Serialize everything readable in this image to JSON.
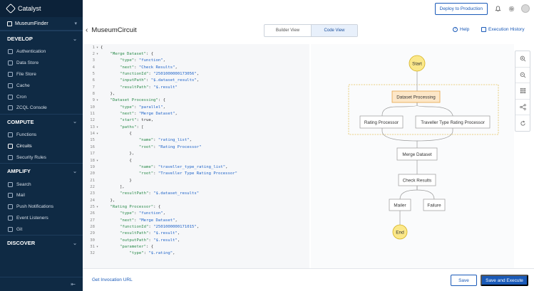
{
  "app": {
    "name": "Catalyst"
  },
  "sidebar": {
    "project": "MuseumFinder",
    "sections": [
      {
        "title": "DEVELOP",
        "items": [
          "Authentication",
          "Data Store",
          "File Store",
          "Cache",
          "Cron",
          "ZCQL Console"
        ]
      },
      {
        "title": "COMPUTE",
        "items": [
          "Functions",
          "Circuits",
          "Security Rules"
        ]
      },
      {
        "title": "AMPLIFY",
        "items": [
          "Search",
          "Mail",
          "Push Notifications",
          "Event Listeners",
          "Git"
        ]
      },
      {
        "title": "DISCOVER",
        "items": []
      }
    ],
    "active_item": "Circuits"
  },
  "topbar": {
    "deploy_label": "Deploy to Production"
  },
  "header": {
    "title": "MuseumCircuit",
    "tabs": [
      "Builder View",
      "Code View"
    ],
    "active_tab": "Code View",
    "help_label": "Help",
    "history_label": "Execution History"
  },
  "code": {
    "lines": [
      {
        "n": "1",
        "fold": true,
        "t": "{"
      },
      {
        "n": "2",
        "fold": true,
        "t": "    \"Merge Dataset\": {"
      },
      {
        "n": "3",
        "fold": false,
        "t": "        \"type\": \"function\","
      },
      {
        "n": "4",
        "fold": false,
        "t": "        \"next\": \"Check Results\","
      },
      {
        "n": "5",
        "fold": false,
        "t": "        \"functionId\": \"2501000000173056\","
      },
      {
        "n": "6",
        "fold": false,
        "t": "        \"inputPath\": \"$.dataset_results\","
      },
      {
        "n": "7",
        "fold": false,
        "t": "        \"resultPath\": \"$.result\""
      },
      {
        "n": "8",
        "fold": false,
        "t": "    },"
      },
      {
        "n": "9",
        "fold": true,
        "t": "    \"Dataset Processing\": {"
      },
      {
        "n": "10",
        "fold": false,
        "t": "        \"type\": \"parallel\","
      },
      {
        "n": "11",
        "fold": false,
        "t": "        \"next\": \"Merge Dataset\","
      },
      {
        "n": "12",
        "fold": false,
        "t": "        \"start\": true,"
      },
      {
        "n": "13",
        "fold": true,
        "t": "        \"paths\": ["
      },
      {
        "n": "14",
        "fold": true,
        "t": "            {"
      },
      {
        "n": "15",
        "fold": false,
        "t": "                \"name\": \"rating_list\","
      },
      {
        "n": "16",
        "fold": false,
        "t": "                \"root\": \"Rating Processor\""
      },
      {
        "n": "17",
        "fold": false,
        "t": "            },"
      },
      {
        "n": "18",
        "fold": true,
        "t": "            {"
      },
      {
        "n": "19",
        "fold": false,
        "t": "                \"name\": \"traveller_type_rating_list\","
      },
      {
        "n": "20",
        "fold": false,
        "t": "                \"root\": \"Traveller Type Rating Processor\""
      },
      {
        "n": "21",
        "fold": false,
        "t": "            }"
      },
      {
        "n": "22",
        "fold": false,
        "t": "        ],"
      },
      {
        "n": "23",
        "fold": false,
        "t": "        \"resultPath\": \"$.dataset_results\""
      },
      {
        "n": "24",
        "fold": false,
        "t": "    },"
      },
      {
        "n": "25",
        "fold": true,
        "t": "    \"Rating Processor\": {"
      },
      {
        "n": "26",
        "fold": false,
        "t": "        \"type\": \"function\","
      },
      {
        "n": "27",
        "fold": false,
        "t": "        \"next\": \"Merge Dataset\","
      },
      {
        "n": "28",
        "fold": false,
        "t": "        \"functionId\": \"2501000000171015\","
      },
      {
        "n": "29",
        "fold": false,
        "t": "        \"resultPath\": \"$.result\","
      },
      {
        "n": "30",
        "fold": false,
        "t": "        \"outputPath\": \"$.result\","
      },
      {
        "n": "31",
        "fold": true,
        "t": "        \"parameter\": {"
      },
      {
        "n": "32",
        "fold": false,
        "t": "            \"type\": \"$.rating\","
      }
    ]
  },
  "flow": {
    "start": "Start",
    "parallel": "Dataset Processing",
    "branch_a": "Rating Processor",
    "branch_b": "Traveller Type Rating Processor",
    "merge": "Merge Dataset",
    "check": "Check Results",
    "mailer": "Mailer",
    "failure": "Failure",
    "end": "End",
    "colors": {
      "terminal_fill": "#fbe88a",
      "terminal_stroke": "#d4b11f",
      "parallel_fill": "#fde7c8",
      "parallel_stroke": "#e7a547",
      "dashed_stroke": "#e3c15a"
    }
  },
  "tools": [
    "zoom-in-icon",
    "zoom-out-icon",
    "grid-icon",
    "share-icon",
    "refresh-icon"
  ],
  "bottom": {
    "invoke_label": "Get Invocation URL",
    "save_label": "Save",
    "execute_label": "Save and Execute"
  }
}
